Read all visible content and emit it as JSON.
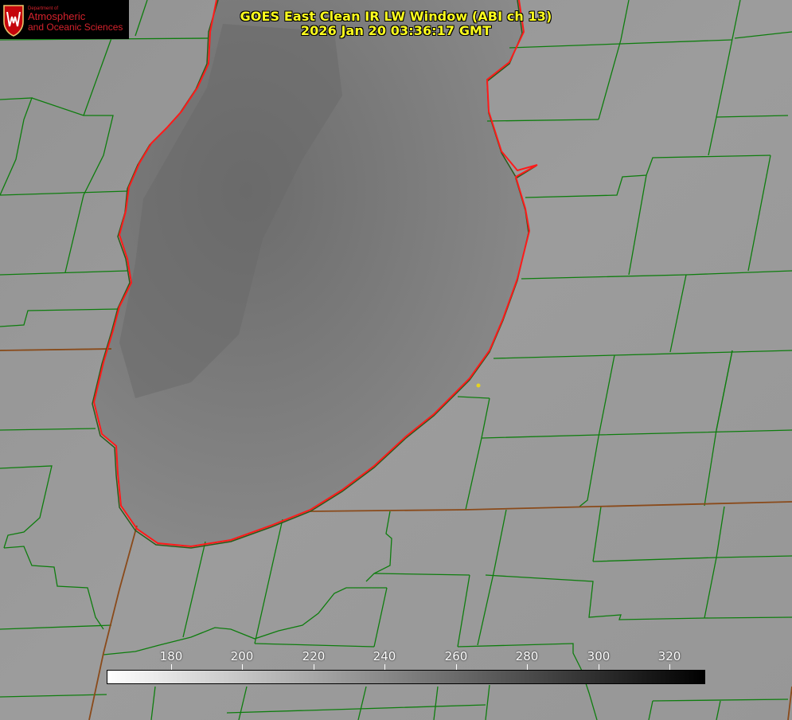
{
  "title": {
    "line1": "GOES East Clean IR LW Window (ABI ch 13)",
    "line2": "2026 Jan 20 03:36:17 GMT"
  },
  "logo": {
    "department": "Department of",
    "line1": "Atmospheric",
    "line2": "and Oceanic Sciences"
  },
  "colorbar": {
    "ticks": [
      "180",
      "200",
      "220",
      "240",
      "260",
      "280",
      "300",
      "320"
    ]
  },
  "colors": {
    "title": "#ffff1e",
    "shoreline": "#ff1a1a",
    "county_lines": "#0e7d0e",
    "state_lines": "#8a4a1a",
    "point_marker": "#e6d21e",
    "logo_text": "#d4222c"
  }
}
